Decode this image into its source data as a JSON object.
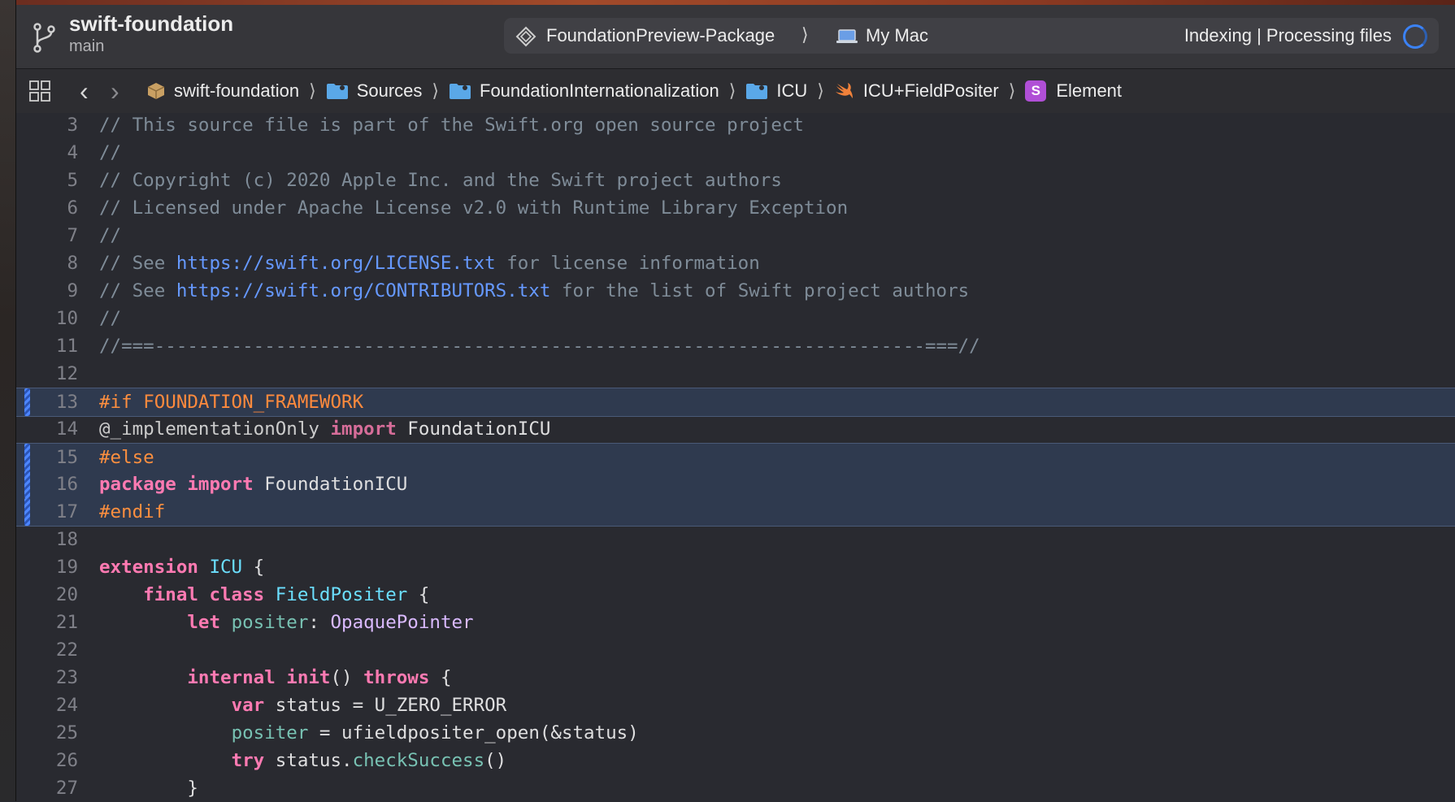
{
  "toolbar": {
    "project_name": "swift-foundation",
    "branch": "main",
    "scheme": "FoundationPreview-Package",
    "destination": "My Mac",
    "status": "Indexing | Processing files"
  },
  "jumpbar": {
    "crumbs": [
      "swift-foundation",
      "Sources",
      "FoundationInternationalization",
      "ICU",
      "ICU+FieldPositer",
      "Element"
    ]
  },
  "colors": {
    "accent": "#3b82f6",
    "keyword": "#ff7ab2",
    "preprocessor": "#fd8f3f",
    "type": "#6bdfff",
    "comment": "#7f8c98",
    "url": "#6699ff",
    "highlight": "#2f3a4f"
  },
  "editor": {
    "lines": [
      {
        "n": "3",
        "t": [
          [
            "c-cm",
            "// This source file is part of the Swift.org open source project"
          ]
        ]
      },
      {
        "n": "4",
        "t": [
          [
            "c-cm",
            "//"
          ]
        ]
      },
      {
        "n": "5",
        "t": [
          [
            "c-cm",
            "// Copyright (c) 2020 Apple Inc. and the Swift project authors"
          ]
        ]
      },
      {
        "n": "6",
        "t": [
          [
            "c-cm",
            "// Licensed under Apache License v2.0 with Runtime Library Exception"
          ]
        ]
      },
      {
        "n": "7",
        "t": [
          [
            "c-cm",
            "//"
          ]
        ]
      },
      {
        "n": "8",
        "t": [
          [
            "c-cm",
            "// See "
          ],
          [
            "c-url",
            "https://swift.org/LICENSE.txt"
          ],
          [
            "c-cm",
            " for license information"
          ]
        ]
      },
      {
        "n": "9",
        "t": [
          [
            "c-cm",
            "// See "
          ],
          [
            "c-url",
            "https://swift.org/CONTRIBUTORS.txt"
          ],
          [
            "c-cm",
            " for the list of Swift project authors"
          ]
        ]
      },
      {
        "n": "10",
        "t": [
          [
            "c-cm",
            "//"
          ]
        ]
      },
      {
        "n": "11",
        "t": [
          [
            "c-cm",
            "//===----------------------------------------------------------------------===//"
          ]
        ]
      },
      {
        "n": "12",
        "t": []
      },
      {
        "n": "13",
        "hl": "single",
        "t": [
          [
            "c-pp",
            "#if "
          ],
          [
            "c-pp2",
            "FOUNDATION_FRAMEWORK"
          ]
        ]
      },
      {
        "n": "14",
        "t": [
          [
            "c-attr",
            "@_implementationOnly "
          ],
          [
            "c-imp",
            "import"
          ],
          [
            "",
            " FoundationICU"
          ]
        ]
      },
      {
        "n": "15",
        "hl": "top",
        "t": [
          [
            "c-pp",
            "#else"
          ]
        ]
      },
      {
        "n": "16",
        "hl": "mid",
        "t": [
          [
            "c-kw",
            "package import"
          ],
          [
            "",
            " FoundationICU"
          ]
        ]
      },
      {
        "n": "17",
        "hl": "bot",
        "t": [
          [
            "c-pp",
            "#endif"
          ]
        ]
      },
      {
        "n": "18",
        "t": []
      },
      {
        "n": "19",
        "t": [
          [
            "c-kw",
            "extension "
          ],
          [
            "c-type",
            "ICU"
          ],
          [
            "",
            " {"
          ]
        ]
      },
      {
        "n": "20",
        "t": [
          [
            "",
            "    "
          ],
          [
            "c-kw",
            "final class "
          ],
          [
            "c-type",
            "FieldPositer"
          ],
          [
            "",
            " {"
          ]
        ]
      },
      {
        "n": "21",
        "t": [
          [
            "",
            "        "
          ],
          [
            "c-kw",
            "let "
          ],
          [
            "c-prop",
            "positer"
          ],
          [
            "",
            ": "
          ],
          [
            "c-tp",
            "OpaquePointer"
          ]
        ]
      },
      {
        "n": "22",
        "t": []
      },
      {
        "n": "23",
        "t": [
          [
            "",
            "        "
          ],
          [
            "c-kw",
            "internal init"
          ],
          [
            "",
            "() "
          ],
          [
            "c-kw",
            "throws"
          ],
          [
            "",
            " {"
          ]
        ]
      },
      {
        "n": "24",
        "t": [
          [
            "",
            "            "
          ],
          [
            "c-kw",
            "var"
          ],
          [
            "",
            " status = U_ZERO_ERROR"
          ]
        ]
      },
      {
        "n": "25",
        "t": [
          [
            "",
            "            "
          ],
          [
            "c-prop",
            "positer"
          ],
          [
            "",
            " = ufieldpositer_open(&status)"
          ]
        ]
      },
      {
        "n": "26",
        "t": [
          [
            "",
            "            "
          ],
          [
            "c-kw",
            "try"
          ],
          [
            "",
            " status."
          ],
          [
            "c-fn",
            "checkSuccess"
          ],
          [
            "",
            "()"
          ]
        ]
      },
      {
        "n": "27",
        "t": [
          [
            "",
            "        }"
          ]
        ]
      }
    ]
  }
}
